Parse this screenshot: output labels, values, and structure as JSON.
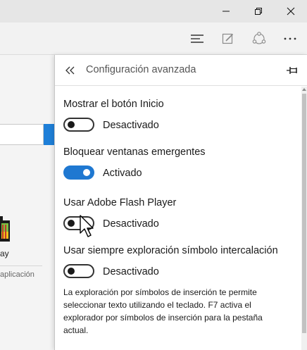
{
  "window_controls": {
    "minimize_icon": "minimize-icon",
    "restore_icon": "restore-icon",
    "close_icon": "close-icon"
  },
  "toolbar": {
    "hub_icon": "hub-icon",
    "note_icon": "web-note-icon",
    "share_icon": "share-icon",
    "more_icon": "more-icon"
  },
  "background_page": {
    "app_label": "ay",
    "app_category": "aplicación"
  },
  "panel": {
    "title": "Configuración avanzada",
    "settings": [
      {
        "label": "Mostrar el botón Inicio",
        "state": "Desactivado",
        "enabled": false
      },
      {
        "label": "Bloquear ventanas emergentes",
        "state": "Activado",
        "enabled": true
      },
      {
        "label": "Usar Adobe Flash Player",
        "state": "Desactivado",
        "enabled": false
      },
      {
        "label": "Usar siempre exploración símbolo intercalación",
        "state": "Desactivado",
        "enabled": false
      }
    ],
    "description": "La exploración por símbolos de inserción te permite seleccionar texto utilizando el teclado. F7 activa el explorador por símbolos de inserción para la pestaña actual."
  },
  "colors": {
    "accent": "#1f78d1",
    "titlebar": "#e6e6e6",
    "toolbar": "#f2f2f2"
  }
}
